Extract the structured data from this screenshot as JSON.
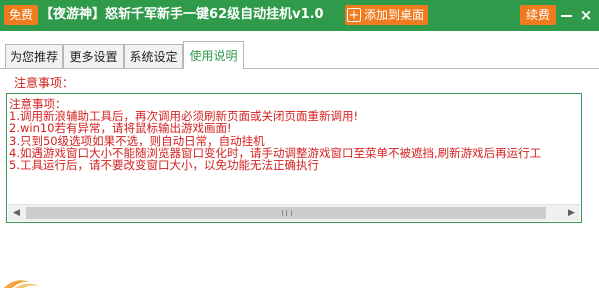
{
  "titlebar": {
    "free_badge": "免费",
    "title": "【夜游神】怒斩千军新手一键62级自动挂机v1.0",
    "add_desktop": "添加到桌面",
    "renew": "续费",
    "close_symbol": "×"
  },
  "tabs": [
    {
      "label": "为您推荐",
      "active": false
    },
    {
      "label": "更多设置",
      "active": false
    },
    {
      "label": "系统设定",
      "active": false
    },
    {
      "label": "使用说明",
      "active": true
    }
  ],
  "notice": {
    "heading": "注意事项：",
    "box_heading": "注意事项：",
    "lines": [
      "1.调用新浪辅助工具后，再次调用必须刷新页面或关闭页面重新调用!",
      "2.win10若有异常，请将鼠标输出游戏画面!",
      "3.只到50级选项如果不选，则自动日常，自动挂机",
      "4.如遇游戏窗口大小不能随浏览器窗口变化时，请手动调整游戏窗口至菜单不被遮挡,刷新游戏后再运行工",
      "5.工具运行后，请不要改变窗口大小，以免功能无法正确执行"
    ]
  },
  "colors": {
    "title_green": "#2e9a4a",
    "badge_orange": "#f07a1e",
    "notice_red": "#d42020",
    "active_tab_text": "#2e9a4a"
  },
  "icons": {
    "minimize": "minimize-icon",
    "close": "close-icon",
    "plus": "plus-icon",
    "scroll_left": "chevron-left-icon",
    "scroll_right": "chevron-right-icon"
  }
}
